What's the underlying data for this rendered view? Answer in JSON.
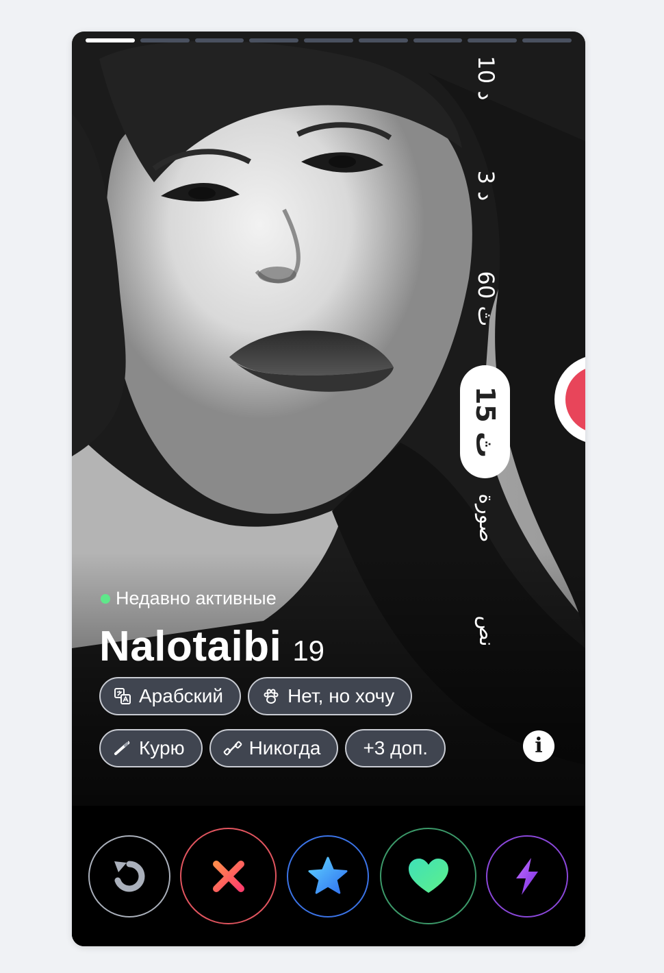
{
  "card": {
    "photo_count": 9,
    "active_photo_index": 0
  },
  "camera_overlay": {
    "label_10": "10 د",
    "label_3": "3 د",
    "label_60": "60 ث",
    "label_15": "15 ث",
    "label_photo": "صورة",
    "label_text": "نص"
  },
  "profile": {
    "status": "Недавно активные",
    "status_color": "#5fe88a",
    "name": "Nalotaibi",
    "age": "19",
    "chips_row1": [
      {
        "icon": "translate-icon",
        "label": "Арабский"
      },
      {
        "icon": "paw-icon",
        "label": "Нет, но хочу"
      }
    ],
    "chips_row2": [
      {
        "icon": "cigarette-icon",
        "label": "Курю"
      },
      {
        "icon": "dumbbell-icon",
        "label": "Никогда"
      },
      {
        "icon": "",
        "label": "+3 доп."
      }
    ],
    "info_label": "i"
  },
  "actions": [
    {
      "name": "rewind",
      "icon": "rewind-icon",
      "color": "#aab0bb"
    },
    {
      "name": "nope",
      "icon": "x-icon",
      "color": "#ff4f5e"
    },
    {
      "name": "super-like",
      "icon": "star-icon",
      "color": "#3b9bff"
    },
    {
      "name": "like",
      "icon": "heart-icon",
      "color": "#3fd6a0"
    },
    {
      "name": "boost",
      "icon": "bolt-icon",
      "color": "#a24cf0"
    }
  ]
}
